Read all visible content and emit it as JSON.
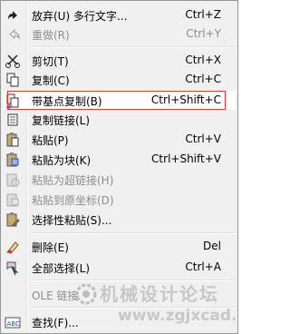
{
  "menu": {
    "items": [
      {
        "label": "放弃(U) 多行文字...",
        "shortcut": "Ctrl+Z",
        "icon": "undo-icon",
        "disabled": false
      },
      {
        "label": "重做(R)",
        "shortcut": "Ctrl+Y",
        "icon": "redo-icon",
        "disabled": true
      },
      {
        "label": "剪切(T)",
        "shortcut": "Ctrl+X",
        "icon": "scissors-icon",
        "disabled": false
      },
      {
        "label": "复制(C)",
        "shortcut": "Ctrl+C",
        "icon": "copy-icon",
        "disabled": false
      },
      {
        "label": "带基点复制(B)",
        "shortcut": "Ctrl+Shift+C",
        "icon": "copy-base-point-icon",
        "disabled": false,
        "highlighted": true
      },
      {
        "label": "复制链接(L)",
        "shortcut": "",
        "icon": "copy-link-icon",
        "disabled": false
      },
      {
        "label": "粘贴(P)",
        "shortcut": "Ctrl+V",
        "icon": "paste-icon",
        "disabled": false
      },
      {
        "label": "粘贴为块(K)",
        "shortcut": "Ctrl+Shift+V",
        "icon": "paste-block-icon",
        "disabled": false
      },
      {
        "label": "粘贴为超链接(H)",
        "shortcut": "",
        "icon": "paste-hyperlink-icon",
        "disabled": true
      },
      {
        "label": "粘贴到原坐标(D)",
        "shortcut": "",
        "icon": "paste-orig-coords-icon",
        "disabled": true
      },
      {
        "label": "选择性粘贴(S)...",
        "shortcut": "",
        "icon": "paste-special-icon",
        "disabled": false
      },
      {
        "label": "删除(E)",
        "shortcut": "Del",
        "icon": "eraser-icon",
        "disabled": false
      },
      {
        "label": "全部选择(L)",
        "shortcut": "Ctrl+A",
        "icon": "select-all-icon",
        "disabled": false
      },
      {
        "label": "OLE 链接",
        "shortcut": "",
        "icon": "",
        "disabled": true
      },
      {
        "label": "查找(F)...",
        "shortcut": "",
        "icon": "find-icon",
        "disabled": false
      }
    ]
  },
  "watermark": {
    "line1": "机械设计论坛",
    "line2": "www.zgjxcad.com"
  },
  "colors": {
    "highlight_border": "#e23a3a",
    "disabled_text": "#8d8d8d"
  }
}
